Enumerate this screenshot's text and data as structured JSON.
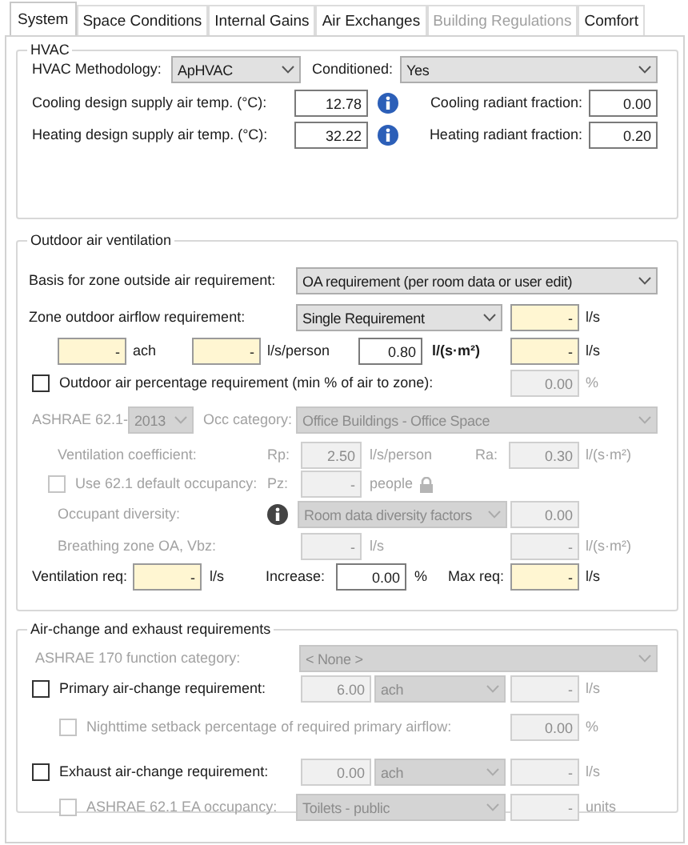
{
  "tabs": [
    {
      "label": "System",
      "selected": true,
      "disabled": false
    },
    {
      "label": "Space Conditions",
      "selected": false,
      "disabled": false
    },
    {
      "label": "Internal Gains",
      "selected": false,
      "disabled": false
    },
    {
      "label": "Air Exchanges",
      "selected": false,
      "disabled": false
    },
    {
      "label": "Building Regulations",
      "selected": false,
      "disabled": true
    },
    {
      "label": "Comfort",
      "selected": false,
      "disabled": false
    }
  ],
  "sections": [
    {
      "title": "HVAC",
      "rows": [
        {
          "items": [
            {
              "kind": "label",
              "text": "HVAC Methodology:",
              "disabled": false
            },
            {
              "kind": "select",
              "value": "ApHVAC",
              "disabled": false
            },
            {
              "kind": "label",
              "text": "Conditioned:",
              "disabled": false
            },
            {
              "kind": "select",
              "value": "Yes",
              "disabled": false
            }
          ]
        },
        {
          "items": [
            {
              "kind": "label",
              "text": "Cooling design supply air temp. (°C):",
              "disabled": false
            },
            {
              "kind": "input",
              "value": "12.78",
              "disabled": false,
              "highlighted": false
            },
            {
              "kind": "info",
              "disabled": false
            },
            {
              "kind": "label",
              "text": "Cooling radiant fraction:",
              "disabled": false
            },
            {
              "kind": "input",
              "value": "0.00",
              "disabled": false,
              "highlighted": false
            }
          ]
        },
        {
          "items": [
            {
              "kind": "label",
              "text": "Heating design supply air temp. (°C):",
              "disabled": false
            },
            {
              "kind": "input",
              "value": "32.22",
              "disabled": false,
              "highlighted": false
            },
            {
              "kind": "info",
              "disabled": false
            },
            {
              "kind": "label",
              "text": "Heating radiant fraction:",
              "disabled": false
            },
            {
              "kind": "input",
              "value": "0.20",
              "disabled": false,
              "highlighted": false
            }
          ]
        }
      ]
    },
    {
      "title": "Outdoor air ventilation",
      "rows": [
        {
          "items": [
            {
              "kind": "label",
              "text": "Basis for zone outside air requirement:",
              "disabled": false
            },
            {
              "kind": "select",
              "value": "OA requirement (per room data or user edit)",
              "disabled": false
            }
          ]
        },
        {
          "items": [
            {
              "kind": "label",
              "text": "Zone outdoor airflow requirement:",
              "disabled": false
            },
            {
              "kind": "select",
              "value": "Single Requirement",
              "disabled": false
            },
            {
              "kind": "input",
              "value": "-",
              "disabled": false,
              "highlighted": true
            },
            {
              "kind": "unit",
              "text": "l/s",
              "disabled": false,
              "bold": false
            }
          ]
        },
        {
          "items": [
            {
              "kind": "input",
              "value": "-",
              "disabled": false,
              "highlighted": true
            },
            {
              "kind": "unit",
              "text": "ach",
              "disabled": false,
              "bold": false
            },
            {
              "kind": "input",
              "value": "-",
              "disabled": false,
              "highlighted": true
            },
            {
              "kind": "unit",
              "text": "l/s/person",
              "disabled": false,
              "bold": false
            },
            {
              "kind": "input",
              "value": "0.80",
              "disabled": false,
              "highlighted": false
            },
            {
              "kind": "unit",
              "text": "l/(s·m²)",
              "disabled": false,
              "bold": true
            },
            {
              "kind": "input",
              "value": "-",
              "disabled": false,
              "highlighted": true
            },
            {
              "kind": "unit",
              "text": "l/s",
              "disabled": false,
              "bold": false
            }
          ]
        },
        {
          "items": [
            {
              "kind": "checkbox",
              "label": "Outdoor air percentage requirement (min % of air to zone):",
              "checked": false,
              "disabled": false
            },
            {
              "kind": "input",
              "value": "0.00",
              "disabled": true,
              "highlighted": false
            },
            {
              "kind": "unit",
              "text": "%",
              "disabled": true,
              "bold": false
            }
          ]
        },
        {
          "items": [
            {
              "kind": "label",
              "text": "ASHRAE 62.1-",
              "disabled": true
            },
            {
              "kind": "select",
              "value": "2013",
              "disabled": true
            },
            {
              "kind": "label",
              "text": "Occ category:",
              "disabled": true
            },
            {
              "kind": "select",
              "value": "Office Buildings - Office Space",
              "disabled": true
            }
          ]
        },
        {
          "items": [
            {
              "kind": "label",
              "text": "Ventilation coefficient:",
              "disabled": true
            },
            {
              "kind": "label",
              "text": "Rp:",
              "disabled": true
            },
            {
              "kind": "input",
              "value": "2.50",
              "disabled": true,
              "highlighted": false
            },
            {
              "kind": "unit",
              "text": "l/s/person",
              "disabled": true,
              "bold": false
            },
            {
              "kind": "label",
              "text": "Ra:",
              "disabled": true
            },
            {
              "kind": "input",
              "value": "0.30",
              "disabled": true,
              "highlighted": false
            },
            {
              "kind": "unit",
              "text": "l/(s·m²)",
              "disabled": true,
              "bold": false
            }
          ]
        },
        {
          "items": [
            {
              "kind": "checkbox",
              "label": "Use 62.1 default occupancy:",
              "checked": false,
              "disabled": true
            },
            {
              "kind": "label",
              "text": "Pz:",
              "disabled": true
            },
            {
              "kind": "input",
              "value": "-",
              "disabled": true,
              "highlighted": false
            },
            {
              "kind": "unit",
              "text": "people",
              "disabled": true,
              "bold": false
            },
            {
              "kind": "lock",
              "disabled": true
            }
          ]
        },
        {
          "items": [
            {
              "kind": "label",
              "text": "Occupant diversity:",
              "disabled": true
            },
            {
              "kind": "info",
              "disabled": true
            },
            {
              "kind": "select",
              "value": "Room data diversity factors",
              "disabled": true
            },
            {
              "kind": "input",
              "value": "0.00",
              "disabled": true,
              "highlighted": false
            }
          ]
        },
        {
          "items": [
            {
              "kind": "label",
              "text": "Breathing zone OA, Vbz:",
              "disabled": true
            },
            {
              "kind": "input",
              "value": "-",
              "disabled": true,
              "highlighted": false
            },
            {
              "kind": "unit",
              "text": "l/s",
              "disabled": true,
              "bold": false
            },
            {
              "kind": "input",
              "value": "-",
              "disabled": true,
              "highlighted": false
            },
            {
              "kind": "unit",
              "text": "l/(s·m²)",
              "disabled": true,
              "bold": false
            }
          ]
        },
        {
          "items": [
            {
              "kind": "label",
              "text": "Ventilation req:",
              "disabled": false
            },
            {
              "kind": "input",
              "value": "-",
              "disabled": false,
              "highlighted": true
            },
            {
              "kind": "unit",
              "text": "l/s",
              "disabled": false,
              "bold": false
            },
            {
              "kind": "label",
              "text": "Increase:",
              "disabled": false
            },
            {
              "kind": "input",
              "value": "0.00",
              "disabled": false,
              "highlighted": false
            },
            {
              "kind": "unit",
              "text": "%",
              "disabled": false,
              "bold": false
            },
            {
              "kind": "label",
              "text": "Max req:",
              "disabled": false
            },
            {
              "kind": "input",
              "value": "-",
              "disabled": false,
              "highlighted": true
            },
            {
              "kind": "unit",
              "text": "l/s",
              "disabled": false,
              "bold": false
            }
          ]
        }
      ]
    },
    {
      "title": "Air-change and exhaust requirements",
      "rows": [
        {
          "items": [
            {
              "kind": "label",
              "text": "ASHRAE 170 function category:",
              "disabled": true
            },
            {
              "kind": "select",
              "value": "< None >",
              "disabled": true
            }
          ]
        },
        {
          "items": [
            {
              "kind": "checkbox",
              "label": "Primary air-change requirement:",
              "checked": false,
              "disabled": false
            },
            {
              "kind": "input",
              "value": "6.00",
              "disabled": true,
              "highlighted": false
            },
            {
              "kind": "select",
              "value": "ach",
              "disabled": true
            },
            {
              "kind": "input",
              "value": "-",
              "disabled": true,
              "highlighted": false
            },
            {
              "kind": "unit",
              "text": "l/s",
              "disabled": true,
              "bold": false
            }
          ]
        },
        {
          "items": [
            {
              "kind": "checkbox",
              "label": "Nighttime setback percentage of required primary airflow:",
              "checked": false,
              "disabled": true
            },
            {
              "kind": "input",
              "value": "0.00",
              "disabled": true,
              "highlighted": false
            },
            {
              "kind": "unit",
              "text": "%",
              "disabled": true,
              "bold": false
            }
          ]
        },
        {
          "items": [
            {
              "kind": "checkbox",
              "label": "Exhaust air-change requirement:",
              "checked": false,
              "disabled": false
            },
            {
              "kind": "input",
              "value": "0.00",
              "disabled": true,
              "highlighted": false
            },
            {
              "kind": "select",
              "value": "ach",
              "disabled": true
            },
            {
              "kind": "input",
              "value": "-",
              "disabled": true,
              "highlighted": false
            },
            {
              "kind": "unit",
              "text": "l/s",
              "disabled": true,
              "bold": false
            }
          ]
        },
        {
          "items": [
            {
              "kind": "checkbox",
              "label": "ASHRAE 62.1 EA occupancy:",
              "checked": false,
              "disabled": true
            },
            {
              "kind": "select",
              "value": "Toilets - public",
              "disabled": true
            },
            {
              "kind": "input",
              "value": "-",
              "disabled": true,
              "highlighted": false
            },
            {
              "kind": "unit",
              "text": "units",
              "disabled": true,
              "bold": false
            }
          ]
        }
      ]
    }
  ]
}
